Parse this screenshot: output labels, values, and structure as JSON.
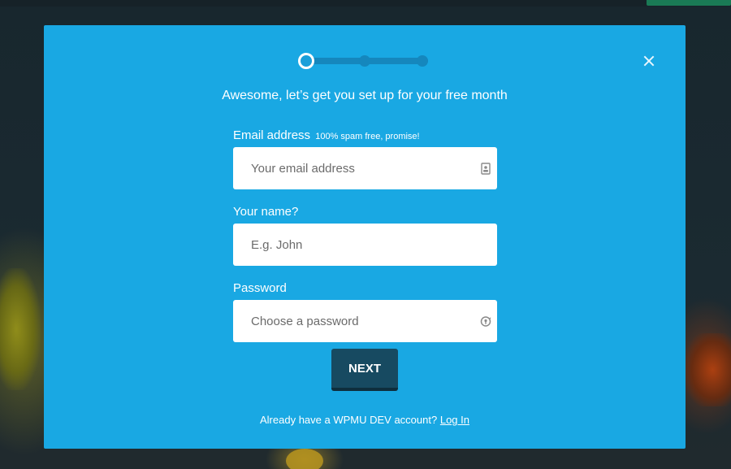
{
  "modal": {
    "headline": "Awesome, let’s get you set up for your free month",
    "progress": {
      "current_step": 1,
      "total_steps": 3
    },
    "close_icon": "close-icon"
  },
  "form": {
    "email": {
      "label": "Email address",
      "hint": "100% spam free, promise!",
      "placeholder": "Your email address",
      "icon": "contact-card-icon"
    },
    "name": {
      "label": "Your name?",
      "placeholder": "E.g. John"
    },
    "password": {
      "label": "Password",
      "placeholder": "Choose a password",
      "icon": "refresh-key-icon"
    },
    "next_label": "NEXT"
  },
  "footer": {
    "prompt": "Already have a WPMU DEV account?",
    "login_label": "Log In"
  },
  "colors": {
    "modal_bg": "#19a8e3",
    "button_bg": "#174a61",
    "progress_track": "#1587bd"
  }
}
